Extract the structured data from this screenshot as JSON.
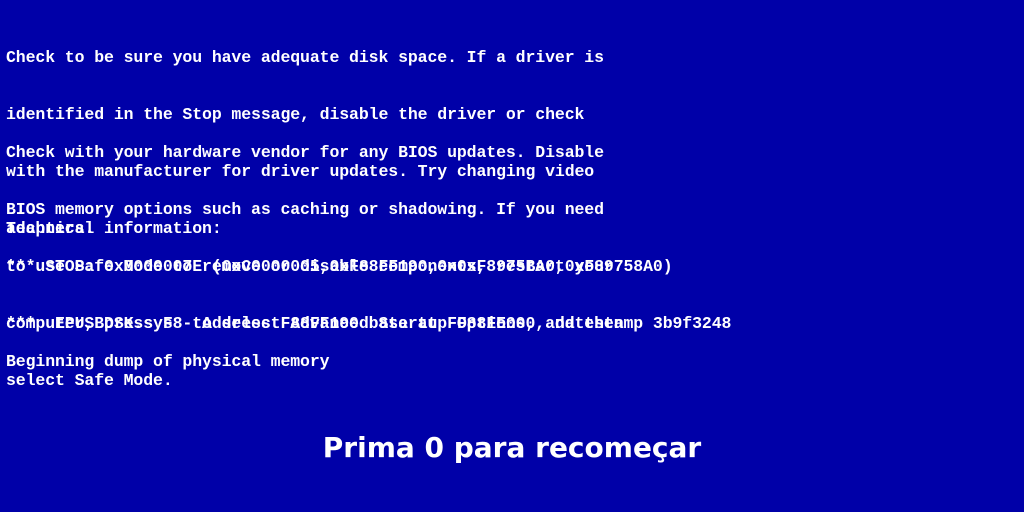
{
  "paragraph1": [
    "Check to be sure you have adequate disk space. If a driver is",
    "identified in the Stop message, disable the driver or check",
    "with the manufacturer for driver updates. Try changing video",
    "adapters."
  ],
  "paragraph2": [
    "Check with your hardware vendor for any BIOS updates. Disable",
    "BIOS memory options such as caching or shadowing. If you need",
    "to use Safe Mode to remove or disable components, restart your",
    "computer, press F8 to select Advanced Startup Options, and then",
    "select Safe Mode."
  ],
  "technical_header": "Technical information:",
  "stop_line": "*** STOP: 0x0000007E (0xC0000005,0xF88FF190,0x0xF8975BA0,0xF89758A0)",
  "driver_line": "***  EPUSBDSK.sys - Address F88FF190 base at FF88FE000, datestamp 3b9f3248",
  "dump_line": "Beginning dump of physical memory",
  "restart_prompt": "Prima 0 para recomeçar",
  "colors": {
    "background": "#0000a8",
    "text": "#ffffff"
  }
}
